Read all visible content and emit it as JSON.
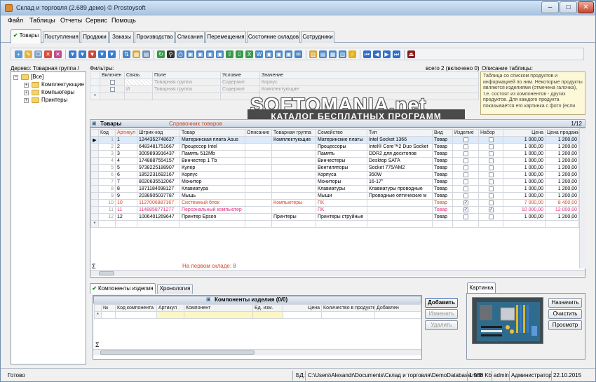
{
  "app": {
    "title": "Склад и торговля (2.689 демо) © Prostoysoft",
    "colors": {
      "accent": "#3f6fb4",
      "pink": "#e0307d",
      "orange": "#d24a2a"
    }
  },
  "window_buttons": {
    "minimize": "–",
    "maximize": "□",
    "close": "✕"
  },
  "menu": [
    "Файл",
    "Таблицы",
    "Отчеты",
    "Сервис",
    "Помощь"
  ],
  "tabs": [
    "Товары",
    "Поступления",
    "Продажи",
    "Заказы",
    "Производство",
    "Списания",
    "Перемещения",
    "Состояние складов",
    "Сотрудники"
  ],
  "tree": {
    "label": "Дерево: Товарная группа /",
    "root": "[Все]",
    "items": [
      "Комплектующие",
      "Компьютеры",
      "Принтеры"
    ]
  },
  "filters": {
    "label": "Фильтры:",
    "total": "всего 2 (включено 0)",
    "columns": [
      "Включен",
      "Связь",
      "Поле",
      "Условие",
      "Значение"
    ],
    "rows": [
      {
        "link": "",
        "field": "Товарная группа",
        "cond": "Содержит",
        "value": "Корпус"
      },
      {
        "link": "И",
        "field": "Товарная группа",
        "cond": "Содержит",
        "value": "Комплектующие"
      }
    ]
  },
  "description": {
    "label": "Описание таблицы:",
    "text": "Таблица со списком продуктов и информацией по ним. Некоторые продукты являются изделиями (отмечена галочка), т.е. состоят из компонентов - других продуктов. Для каждого продукта показывается его картинка с фото (если"
  },
  "watermark": {
    "title": "SOFTOMANIA.net",
    "subtitle": "КАТАЛОГ БЕСПЛАТНЫХ ПРОГРАММ"
  },
  "goods": {
    "title": "Товары",
    "link": "Справочник товаров",
    "page": "1/12",
    "columns": [
      "Код",
      "Артикул",
      "Штрих-код",
      "Товар",
      "Описание",
      "Товарная группа",
      "Семейство",
      "Тип",
      "Вид",
      "Изделие",
      "Набор",
      "Цена",
      "Цена продажи"
    ],
    "rows": [
      {
        "code": "1",
        "art": "1",
        "bar": "1244352748627",
        "name": "Материнская плата Asus",
        "desc": "",
        "group": "Комплектующие",
        "family": "Материнские платы",
        "type": "Intel Socket 1366",
        "kind": "Товар",
        "item": "",
        "set": "",
        "price": "1 000,00",
        "sale": "1 200,00"
      },
      {
        "code": "2",
        "art": "2",
        "bar": "6483481751667",
        "name": "Процессор Intel",
        "desc": "",
        "group": "",
        "family": "Процессоры",
        "type": "Intel® Core™2 Duo Socket",
        "kind": "Товар",
        "item": "",
        "set": "",
        "price": "1 000,00",
        "sale": "1 200,00"
      },
      {
        "code": "3",
        "art": "3",
        "bar": "3009893916437",
        "name": "Память 512Mb",
        "desc": "",
        "group": "",
        "family": "Память",
        "type": "DDR2 для десктопов",
        "kind": "Товар",
        "item": "",
        "set": "",
        "price": "1 000,00",
        "sale": "1 200,00"
      },
      {
        "code": "4",
        "art": "4",
        "bar": "1748887554157",
        "name": "Винчестер 1 Tb",
        "desc": "",
        "group": "",
        "family": "Винчестеры",
        "type": "Desktop SATA",
        "kind": "Товар",
        "item": "",
        "set": "",
        "price": "1 000,00",
        "sale": "1 200,00"
      },
      {
        "code": "5",
        "art": "5",
        "bar": "9738225188907",
        "name": "Кулер",
        "desc": "",
        "group": "",
        "family": "Вентиляторы",
        "type": "Socket 775/AM2",
        "kind": "Товар",
        "item": "",
        "set": "",
        "price": "1 000,00",
        "sale": "1 200,00"
      },
      {
        "code": "6",
        "art": "6",
        "bar": "1852231692167",
        "name": "Корпус",
        "desc": "",
        "group": "",
        "family": "Корпуса",
        "type": "350W",
        "kind": "Товар",
        "item": "",
        "set": "",
        "price": "1 000,00",
        "sale": "1 200,00"
      },
      {
        "code": "7",
        "art": "7",
        "bar": "8020635512067",
        "name": "Монитор",
        "desc": "",
        "group": "",
        "family": "Мониторы",
        "type": "16-17\"",
        "kind": "Товар",
        "item": "",
        "set": "",
        "price": "1 000,00",
        "sale": "1 200,00"
      },
      {
        "code": "8",
        "art": "8",
        "bar": "1871184098127",
        "name": "Клавиатура",
        "desc": "",
        "group": "",
        "family": "Клавиатуры",
        "type": "Клавиатуры проводные",
        "kind": "Товар",
        "item": "",
        "set": "",
        "price": "1 000,00",
        "sale": "1 200,00"
      },
      {
        "code": "9",
        "art": "9",
        "bar": "2038905037787",
        "name": "Мышь",
        "desc": "",
        "group": "",
        "family": "Мыши",
        "type": "Проводные оптические м",
        "kind": "Товар",
        "item": "",
        "set": "",
        "price": "1 000,00",
        "sale": "1 200,00"
      },
      {
        "code": "10",
        "art": "10",
        "bar": "1127006887167",
        "name": "Системный блок",
        "desc": "",
        "group": "Компьютеры",
        "family": "ПК",
        "type": "",
        "kind": "Товар",
        "item": "✓",
        "set": "",
        "price": "7 000,00",
        "sale": "8 400,00"
      },
      {
        "code": "11",
        "art": "11",
        "bar": "1148858771277",
        "name": "Персональный компьютер",
        "desc": "",
        "group": "",
        "family": "ПК",
        "type": "",
        "kind": "Товар",
        "item": "✓",
        "set": "✓",
        "price": "10 000,00",
        "sale": "12 000,00"
      },
      {
        "code": "12",
        "art": "12",
        "bar": "1006401269647",
        "name": "Принтер Epson",
        "desc": "",
        "group": "Принтеры",
        "family": "Принтеры струйные",
        "type": "",
        "kind": "Товар",
        "item": "",
        "set": "",
        "price": "1 000,00",
        "sale": "1 200,00"
      }
    ],
    "footer": "На первом складе: 8",
    "sigma": "Σ",
    "new_row": "*"
  },
  "bottom": {
    "tabs": [
      "Компоненты изделия",
      "Хронология"
    ],
    "title": "Компоненты изделия (0/0)",
    "columns": [
      "№",
      "Код компонента",
      "Артикул",
      "Компонент",
      "Ед. изм.",
      "Цена",
      "Количество в продукте",
      "Добавлен"
    ],
    "buttons": {
      "add": "Добавить",
      "edit": "Изменить",
      "delete": "Удалить"
    },
    "picture_tab": "Картинка",
    "picture_buttons": {
      "assign": "Назначить",
      "clear": "Очистить",
      "view": "Просмотр"
    }
  },
  "status": {
    "ready": "Готово",
    "db_label": "БД:",
    "db_path": "C:\\Users\\Alexandr\\Documents\\Склад и торговля\\DemoDatabase.mdb",
    "size": "1 988 Kb",
    "user": "admin",
    "role": "Администратор",
    "date": "22.10.2015"
  }
}
